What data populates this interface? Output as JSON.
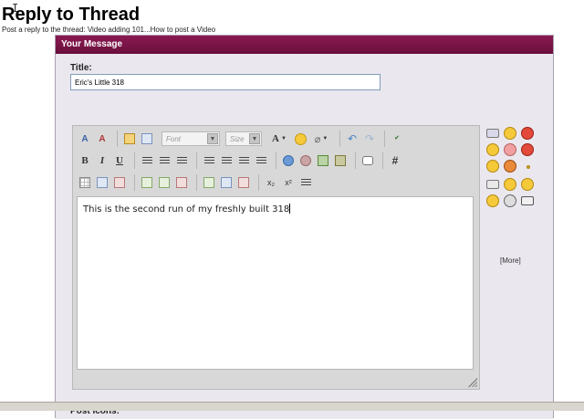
{
  "page": {
    "title": "Reply to Thread",
    "subtitle": "Post a reply to the thread: Video adding 101...How to post a Video"
  },
  "panel": {
    "header": "Your Message",
    "title_label": "Title:",
    "title_value": "Eric's Little 318",
    "editor_text": "This is the second run of my freshly built 318",
    "more_link": "[More]",
    "post_icons_label": "Post Icons:"
  },
  "toolbar": {
    "font_placeholder": "Font",
    "size_placeholder": "Size",
    "bold": "B",
    "italic": "I",
    "underline": "U",
    "quote": "#",
    "font_color": "A",
    "subscript": "x₂",
    "superscript": "x²"
  },
  "colors": {
    "header": "#7a1447",
    "accent": "#6a0f3c"
  }
}
